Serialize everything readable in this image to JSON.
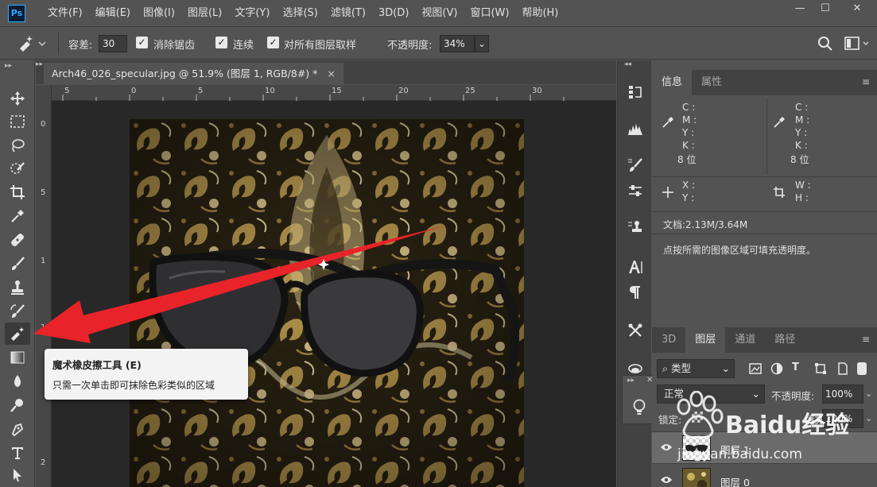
{
  "app": {
    "logo": "Ps"
  },
  "menu": {
    "items": [
      "文件(F)",
      "编辑(E)",
      "图像(I)",
      "图层(L)",
      "文字(Y)",
      "选择(S)",
      "滤镜(T)",
      "3D(D)",
      "视图(V)",
      "窗口(W)",
      "帮助(H)"
    ]
  },
  "window_controls": {
    "minimize": "—",
    "maximize": "☐",
    "close": "✕"
  },
  "options": {
    "tolerance_label": "容差:",
    "tolerance_value": "30",
    "antialias_label": "消除锯齿",
    "contiguous_label": "连续",
    "sample_all_label": "对所有图层取样",
    "opacity_label": "不透明度:",
    "opacity_value": "34%"
  },
  "document": {
    "tab_title": "Arch46_026_specular.jpg @ 51.9% (图层 1, RGB/8#) *",
    "tab_close": "×",
    "ruler_top": [
      "5",
      "0",
      "5",
      "10",
      "15",
      "20",
      "25",
      "30"
    ],
    "ruler_left": [
      "0",
      "5",
      "1",
      "1",
      "2"
    ]
  },
  "tooltip": {
    "title": "魔术橡皮擦工具 (E)",
    "description": "只需一次单击即可抹除色彩类似的区域"
  },
  "info_panel": {
    "tabs": [
      "信息",
      "属性"
    ],
    "cmyk_labels": [
      "C :",
      "M :",
      "Y :",
      "K :"
    ],
    "bits": "8 位",
    "xy_labels": [
      "X :",
      "Y :"
    ],
    "wh_labels": [
      "W :",
      "H :"
    ],
    "doc_size": "文档:2.13M/3.64M",
    "hint": "点按所需的图像区域可填充透明度。"
  },
  "layers_panel": {
    "tabs": [
      "3D",
      "图层",
      "通道",
      "路径"
    ],
    "filter": "类型",
    "blend_mode": "正常",
    "opacity_label": "不透明度:",
    "opacity_value": "100%",
    "lock_label": "锁定:",
    "fill_label": "填充:",
    "fill_value": "100%",
    "layers": [
      {
        "name": "图层 1"
      },
      {
        "name": "图层 0"
      }
    ]
  },
  "watermark": {
    "brand": "Baidu经验",
    "url": "jingyan.baidu.com"
  },
  "colors": {
    "accent": "#31a8ff",
    "arrow": "#e8232a",
    "panel": "#535353",
    "dark": "#424242"
  }
}
